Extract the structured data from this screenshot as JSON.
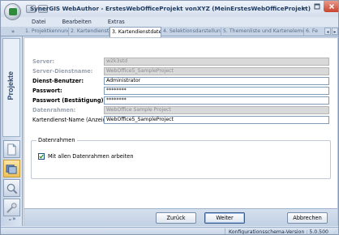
{
  "window": {
    "title": "SynerGIS WebAuthor - ErstesWebOfficeProjekt vonXYZ (MeinErstesWebOfficeProjekt)",
    "controls": [
      "minimize",
      "maximize",
      "close"
    ]
  },
  "menu": [
    "Datei",
    "Bearbeiten",
    "Extras"
  ],
  "tabs": {
    "items": [
      {
        "label": "1. Projektkennung"
      },
      {
        "label": "2. Kartendienst"
      },
      {
        "label": "3. Kartendienstdaten"
      },
      {
        "label": "4. Selektionsdarstellung"
      },
      {
        "label": "5. Themenliste und Kartenelemente"
      },
      {
        "label": "6. Fe"
      }
    ],
    "active_index": 2,
    "collapse_glyph": "»",
    "scroll_left": "◂",
    "scroll_right": "▸"
  },
  "sidebar": {
    "label": "Projekte",
    "chevron": "⌄»",
    "buttons": [
      "document-icon",
      "map-stack-icon",
      "magnifier-icon",
      "tools-icon"
    ],
    "active_button": 1
  },
  "form": {
    "fields": [
      {
        "label": "Server:",
        "value": "w2k3std",
        "enabled": false,
        "bold": true
      },
      {
        "label": "Server-Dienstname:",
        "value": "WebOffice5_SampleProject",
        "enabled": false,
        "bold": true
      },
      {
        "label": "Dienst-Benutzer:",
        "value": "Administrator",
        "enabled": true,
        "bold": true
      },
      {
        "label": "Passwort:",
        "value": "********",
        "enabled": true,
        "bold": true
      },
      {
        "label": "Passwort (Bestätigung):",
        "value": "********",
        "enabled": true,
        "bold": true
      },
      {
        "label": "Datenrahmen:",
        "value": "WebOffice Sample Project",
        "enabled": false,
        "bold": true
      },
      {
        "label": "Kartendienst-Name (Anzeige):",
        "value": "WebOffice5_SampleProject",
        "enabled": true,
        "bold": false
      }
    ]
  },
  "group": {
    "title": "Datenrahmen",
    "checkbox_label": "Mit allen Datenrahmen arbeiten",
    "checked": true
  },
  "buttons": {
    "back": "Zurück",
    "next": "Weiter",
    "cancel": "Abbrechen"
  },
  "status": {
    "text": "Konfigurationsschema-Version : 5.0.500"
  }
}
